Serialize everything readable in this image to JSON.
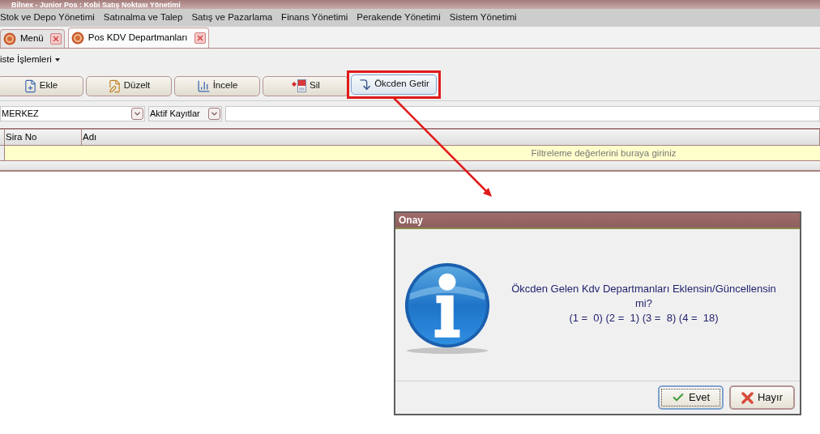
{
  "window": {
    "title": "Bilnex - Junior Pos : Kobi Satış Noktası Yönetimi"
  },
  "menu_bar": [
    "Stok ve Depo Yönetimi",
    "Satınalma ve Talep",
    "Satış ve Pazarlama",
    "Finans Yönetimi",
    "Perakende Yönetimi",
    "Sistem Yönetimi"
  ],
  "tabs": [
    {
      "label": "Menü",
      "selected": false
    },
    {
      "label": "Pos KDV Departmanları",
      "selected": true
    }
  ],
  "list_menu": {
    "label": "iste İşlemleri"
  },
  "toolbar": [
    {
      "label": "Ekle",
      "kind": "add",
      "hovered": false,
      "annotated": false
    },
    {
      "label": "Düzelt",
      "kind": "edit",
      "hovered": false,
      "annotated": false
    },
    {
      "label": "İncele",
      "kind": "view",
      "hovered": false,
      "annotated": false
    },
    {
      "label": "Sil",
      "kind": "delete",
      "hovered": false,
      "annotated": false
    },
    {
      "label": "Ökcden Getir",
      "kind": "fetch",
      "hovered": true,
      "annotated": true
    }
  ],
  "filters": [
    {
      "kind": "combo",
      "value": "MERKEZ"
    },
    {
      "kind": "combo",
      "value": "Aktif Kayıtlar"
    },
    {
      "kind": "text"
    }
  ],
  "grid": {
    "columns": [
      "Sira No",
      "Adı"
    ],
    "filter_row": {
      "placeholder": "Filtreleme değerlerini buraya giriniz"
    }
  },
  "dialog": {
    "title": "Onay",
    "message": "Ökcden Gelen Kdv Departmanları Eklensin/Güncellensin mi?",
    "details": "(1 =  0) (2 =  1) (3 =  8) (4 =  18)",
    "buttons": [
      {
        "label": "Evet",
        "kind": "yes",
        "focused": true
      },
      {
        "label": "Hayır",
        "kind": "no",
        "focused": false
      }
    ]
  }
}
